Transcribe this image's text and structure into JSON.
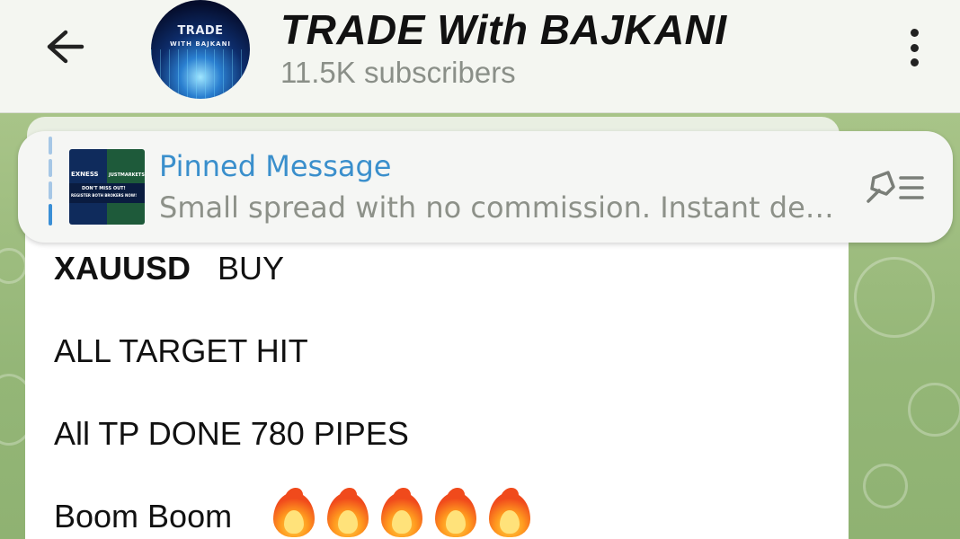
{
  "header": {
    "back_icon": "arrow-left-icon",
    "channel_title": "TRADE With BAJKANI",
    "subscribers": "11.5K subscribers",
    "avatar_text_top": "TRADE",
    "avatar_text_bottom": "WITH BAJKANI",
    "menu_icon": "more-vertical-icon"
  },
  "pinned": {
    "title": "Pinned Message",
    "preview": "Small spread with no commission. Instant de…",
    "thumbnail": {
      "left_label": "EXNESS",
      "right_label": "JUSTMARKETS",
      "center_line1": "DON'T MISS OUT!",
      "center_line2": "REGISTER BOTH BROKERS NOW!"
    },
    "list_icon": "pinned-list-icon"
  },
  "message": {
    "line1_symbol": "XAUUSD",
    "line1_action": "BUY",
    "line2": "ALL TARGET HIT",
    "line3": "All TP DONE 780 PIPES",
    "line4": "Boom Boom",
    "emoji_count": 5,
    "emoji_icon": "fire-emoji-icon"
  },
  "colors": {
    "header_bg": "#f4f6f1",
    "accent": "#3a8fcc",
    "wallpaper": "#9dbb7c"
  }
}
